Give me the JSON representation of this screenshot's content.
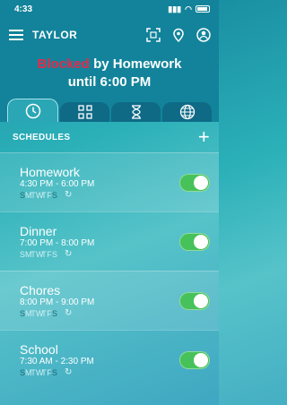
{
  "status": {
    "time": "4:33"
  },
  "header": {
    "title": "TAYLOR"
  },
  "blocked": {
    "prefix": "Blocked",
    "suffix": " by Homework",
    "line2": "until 6:00 PM"
  },
  "tabs": [
    {
      "name": "clock-icon",
      "active": true
    },
    {
      "name": "apps-icon",
      "active": false
    },
    {
      "name": "hourglass-icon",
      "active": false
    },
    {
      "name": "globe-icon",
      "active": false
    }
  ],
  "schedules": {
    "header": "SCHEDULES",
    "items": [
      {
        "name": "Homework",
        "time": "4:30 PM - 6:00 PM",
        "days": [
          "S",
          "M",
          "T",
          "W",
          "T",
          "F",
          "S"
        ],
        "on": [
          0,
          1,
          1,
          1,
          1,
          1,
          0
        ],
        "repeat": "↻",
        "enabled": true
      },
      {
        "name": "Dinner",
        "time": "7:00 PM - 8:00 PM",
        "days": [
          "S",
          "M",
          "T",
          "W",
          "T",
          "F",
          "S"
        ],
        "on": [
          1,
          1,
          1,
          1,
          1,
          1,
          1
        ],
        "repeat": "↻",
        "enabled": true
      },
      {
        "name": "Chores",
        "time": "8:00 PM - 9:00 PM",
        "days": [
          "S",
          "M",
          "T",
          "W",
          "T",
          "F",
          "S"
        ],
        "on": [
          0,
          1,
          1,
          1,
          1,
          1,
          0
        ],
        "repeat": "↻",
        "enabled": true
      },
      {
        "name": "School",
        "time": "7:30 AM - 2:30 PM",
        "days": [
          "S",
          "M",
          "T",
          "W",
          "T",
          "F",
          "S"
        ],
        "on": [
          0,
          1,
          1,
          1,
          1,
          1,
          0
        ],
        "repeat": "↻",
        "enabled": true
      }
    ]
  },
  "colors": {
    "accent_red": "#e8294a",
    "toggle_green": "#47c25a"
  }
}
